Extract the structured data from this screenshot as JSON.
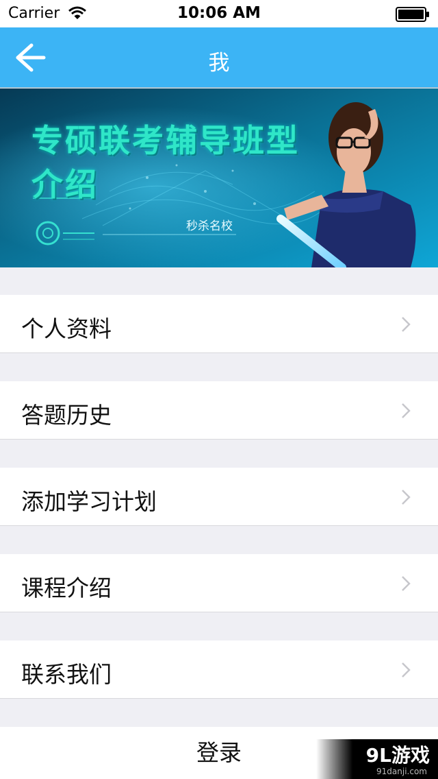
{
  "status_bar": {
    "carrier": "Carrier",
    "time": "10:06 AM"
  },
  "nav": {
    "title": "我",
    "back_icon": "arrow-left-icon",
    "color": "#3cb4f5"
  },
  "banner": {
    "title_line1": "专硕联考辅导班型",
    "title_line2": "介绍",
    "subtitle": "秒杀名校"
  },
  "menu": {
    "items": [
      {
        "label": "个人资料"
      },
      {
        "label": "答题历史"
      },
      {
        "label": "添加学习计划"
      },
      {
        "label": "课程介绍"
      },
      {
        "label": "联系我们"
      }
    ],
    "chevron_icon": "chevron-right-icon"
  },
  "login": {
    "label": "登录"
  },
  "watermark": {
    "logo": "9L游戏",
    "url": "91danji.com"
  }
}
